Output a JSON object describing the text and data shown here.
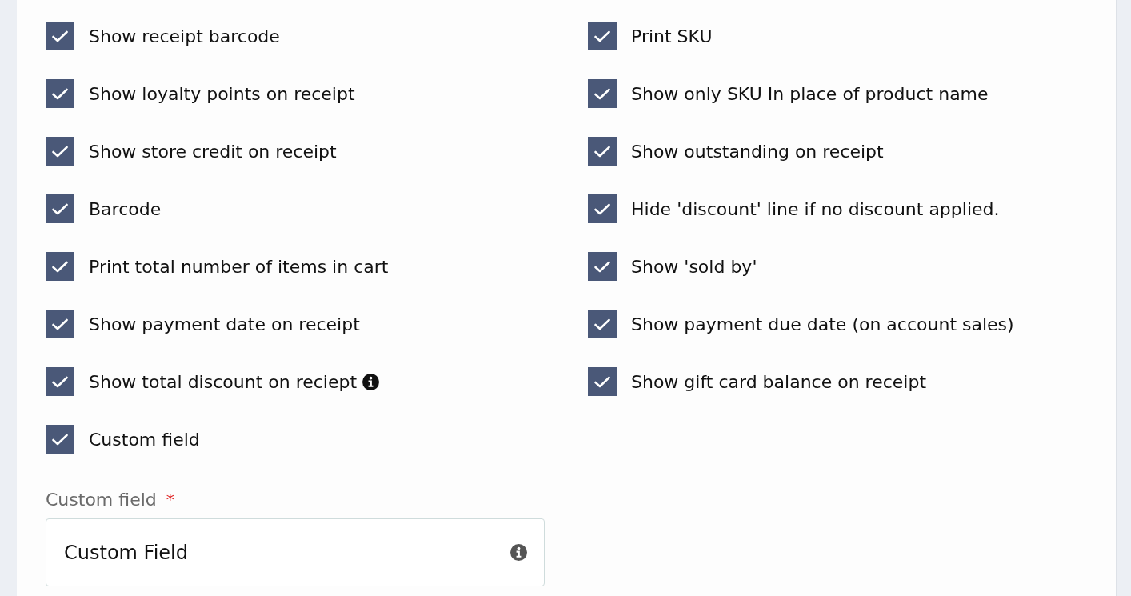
{
  "options": {
    "left_column": [
      {
        "label": "Show receipt barcode",
        "checked": true,
        "info": false
      },
      {
        "label": "Show loyalty points on receipt",
        "checked": true,
        "info": false
      },
      {
        "label": "Show store credit on receipt",
        "checked": true,
        "info": false
      },
      {
        "label": "Barcode",
        "checked": true,
        "info": false
      },
      {
        "label": "Print total number of items in cart",
        "checked": true,
        "info": false
      },
      {
        "label": "Show payment date on receipt",
        "checked": true,
        "info": false
      },
      {
        "label": "Show total discount on reciept",
        "checked": true,
        "info": true
      },
      {
        "label": "Custom field",
        "checked": true,
        "info": false
      }
    ],
    "right_column": [
      {
        "label": "Print SKU",
        "checked": true,
        "info": false
      },
      {
        "label": "Show only SKU In place of product name",
        "checked": true,
        "info": false
      },
      {
        "label": "Show outstanding on receipt",
        "checked": true,
        "info": false
      },
      {
        "label": "Hide 'discount' line if no discount applied.",
        "checked": true,
        "info": false
      },
      {
        "label": "Show 'sold by'",
        "checked": true,
        "info": false
      },
      {
        "label": "Show payment due date (on account sales)",
        "checked": true,
        "info": false
      },
      {
        "label": "Show gift card balance on receipt",
        "checked": true,
        "info": false
      }
    ]
  },
  "custom_field": {
    "label": "Custom field",
    "required_mark": "*",
    "value": "Custom Field",
    "info": true
  }
}
